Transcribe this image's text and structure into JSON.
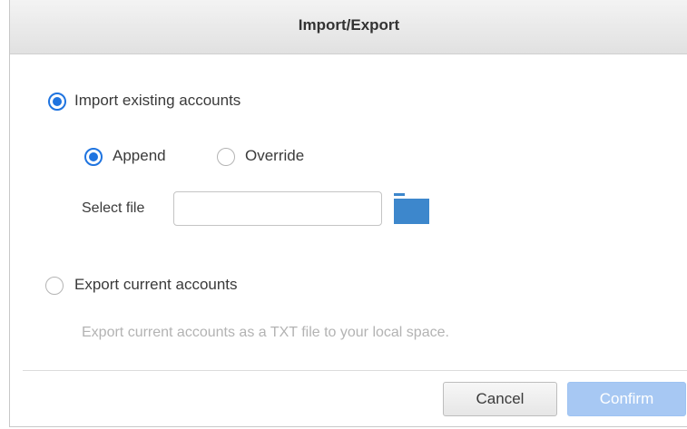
{
  "dialog": {
    "title": "Import/Export"
  },
  "import_option": {
    "label": "Import existing accounts",
    "selected": true,
    "mode": {
      "append_label": "Append",
      "override_label": "Override",
      "selected": "append"
    },
    "select_file_label": "Select file",
    "file_value": "",
    "folder_icon": "folder-icon"
  },
  "export_option": {
    "label": "Export current accounts",
    "selected": false,
    "description": "Export current accounts as a TXT file to your local space."
  },
  "buttons": {
    "cancel_label": "Cancel",
    "confirm_label": "Confirm",
    "confirm_enabled": false
  },
  "colors": {
    "accent": "#1f74e0",
    "folder": "#3d87cc",
    "confirm_disabled": "#a7c8f3"
  }
}
